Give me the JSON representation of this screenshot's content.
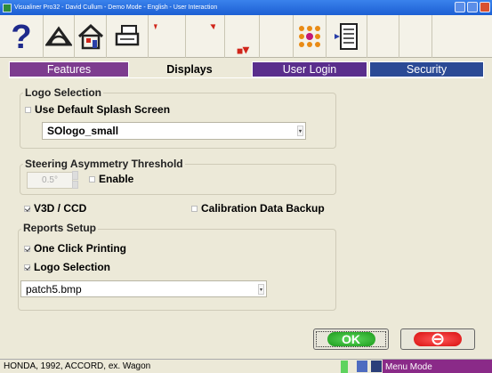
{
  "window": {
    "title": "Visualiner Pro32 - David Cullum - Demo Mode - English - User Interaction"
  },
  "toolbar": {
    "icons": [
      "help-icon",
      "alignment-icon",
      "home-icon",
      "printer-icon",
      "marker-icon",
      "marker-icon",
      "marker-icon",
      "dots-icon",
      "report-icon"
    ]
  },
  "tabs": [
    {
      "label": "Features"
    },
    {
      "label": "Displays"
    },
    {
      "label": "User Login"
    },
    {
      "label": "Security"
    }
  ],
  "logo_selection": {
    "legend": "Logo Selection",
    "use_default_label": "Use Default Splash Screen",
    "use_default_checked": false,
    "selected_value": "SOlogo_small"
  },
  "steering": {
    "legend": "Steering Asymmetry Threshold",
    "value": "0.5°",
    "enable_label": "Enable",
    "enable_checked": false
  },
  "options": {
    "v3d_label": "V3D / CCD",
    "v3d_checked": true,
    "calibration_label": "Calibration Data Backup",
    "calibration_checked": false
  },
  "reports": {
    "legend": "Reports Setup",
    "one_click_label": "One Click Printing",
    "one_click_checked": true,
    "logo_label": "Logo Selection",
    "logo_checked": true,
    "logo_file": "patch5.bmp"
  },
  "buttons": {
    "ok_label": "OK"
  },
  "status": {
    "vehicle": "HONDA, 1992, ACCORD, ex. Wagon",
    "mode": "Menu Mode"
  },
  "colors": {
    "tab_features": "#7d3c8f",
    "tab_user_login": "#5a2e8c",
    "tab_security": "#2b4a95",
    "ok_green": "#1a9a1a",
    "cancel_red": "#d81010",
    "status_mode": "#8a2a88"
  }
}
